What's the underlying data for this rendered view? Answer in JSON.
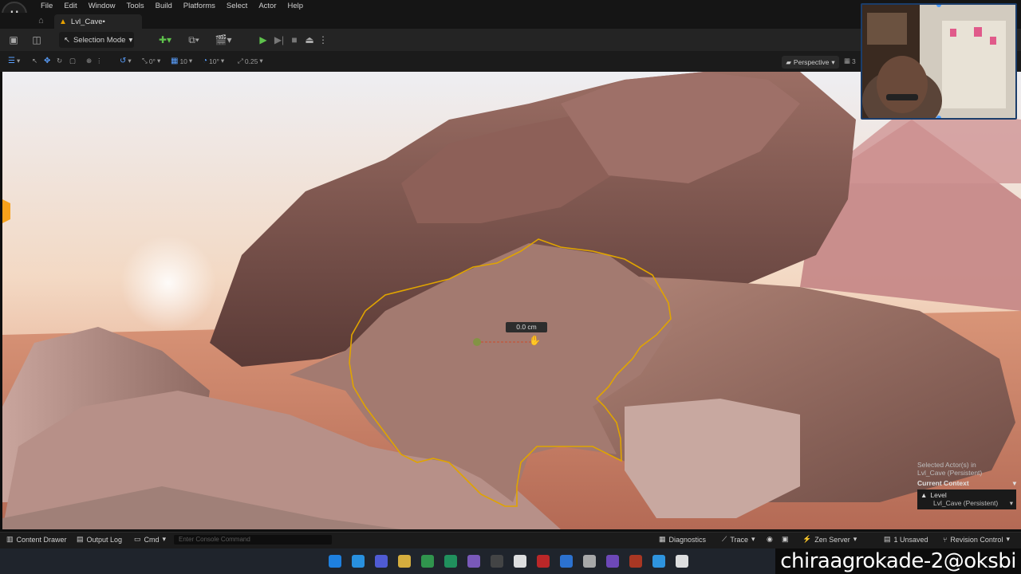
{
  "menus": [
    "File",
    "Edit",
    "Window",
    "Tools",
    "Build",
    "Platforms",
    "Select",
    "Actor",
    "Help"
  ],
  "tab": {
    "label": "Lvl_Cave•"
  },
  "toolbar": {
    "selection_mode": "Selection Mode"
  },
  "viewport_toolbar": {
    "translate_snap": "0°",
    "grid_snap": "10",
    "rotate_snap": "10°",
    "scale_snap": "0.25",
    "perspective": "Perspective",
    "camera_speed": "3"
  },
  "viewport": {
    "measure_label": "0.0 cm"
  },
  "outliner": {
    "selected_actor_line1": "Selected Actor(s) in",
    "selected_actor_line2": "Lvl_Cave (Persistent)",
    "current_context": "Current Context",
    "level_label": "Level",
    "level_value": "Lvl_Cave (Persistent)"
  },
  "statusbar": {
    "content_drawer": "Content Drawer",
    "output_log": "Output Log",
    "cmd": "Cmd",
    "console_placeholder": "Enter Console Command",
    "diagnostics": "Diagnostics",
    "trace": "Trace",
    "zen_server": "Zen Server",
    "unsaved": "1 Unsaved",
    "revision_control": "Revision Control"
  },
  "watermark": "chiraagrokade-2@oksbi",
  "colors": {
    "accent_green": "#5ec24c",
    "selection_outline": "#e0a400",
    "webcam_border": "#1b3d6a"
  },
  "taskbar_icons": [
    "windows-start-icon",
    "edge-icon",
    "discord-icon",
    "explorer-icon",
    "chrome-icon",
    "excel-icon",
    "github-icon",
    "terminal-icon",
    "notes-icon",
    "acrobat-icon",
    "app-icon",
    "obs-icon",
    "vs-icon",
    "app2-icon",
    "photoshop-icon",
    "unreal-icon"
  ]
}
